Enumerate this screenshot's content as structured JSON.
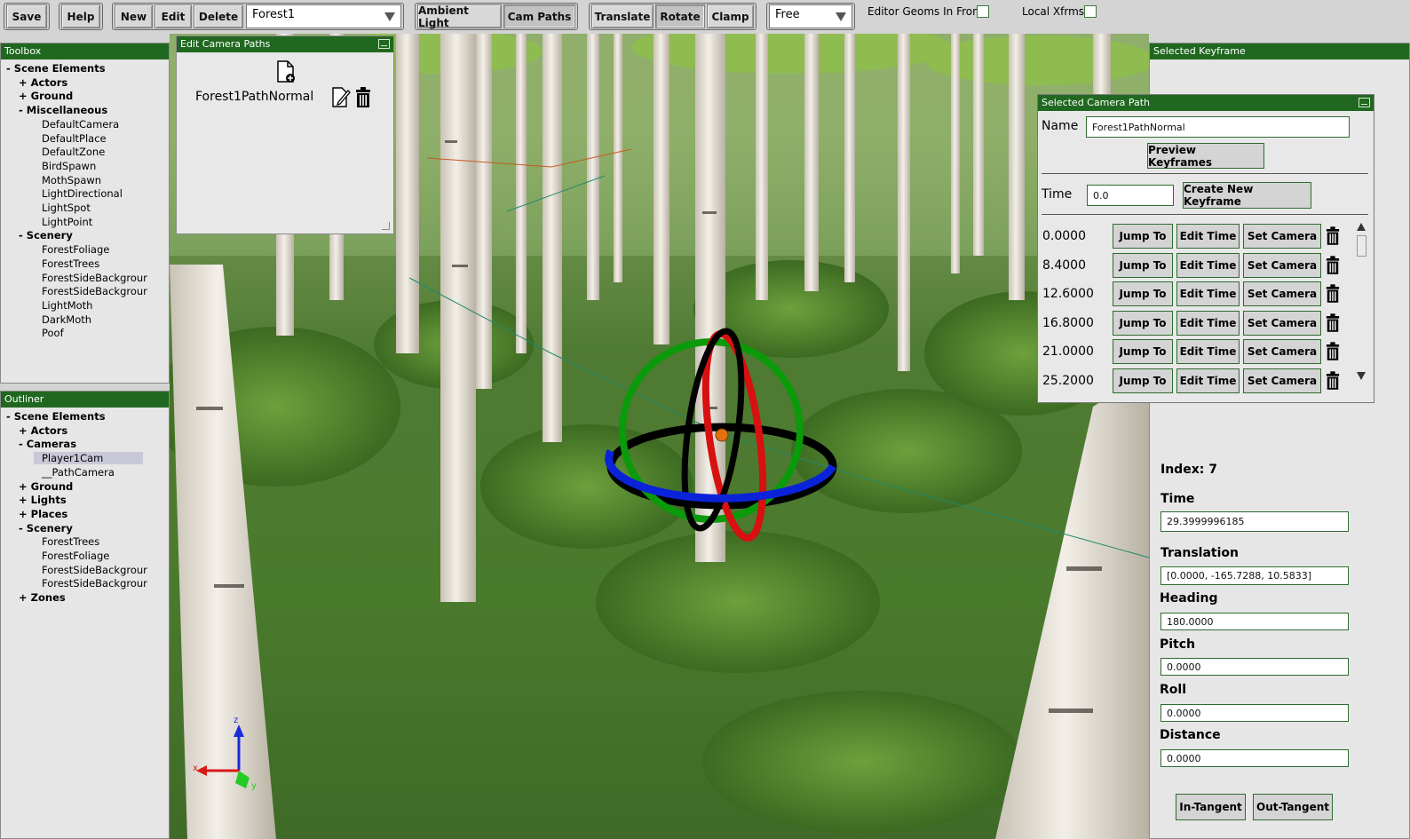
{
  "toolbar": {
    "save": "Save",
    "help": "Help",
    "new": "New",
    "edit": "Edit",
    "delete": "Delete",
    "level_select": "Forest1",
    "ambient_light": "Ambient Light",
    "cam_paths": "Cam Paths",
    "translate": "Translate",
    "rotate": "Rotate",
    "clamp": "Clamp",
    "camera_mode": "Free",
    "editor_geoms_label": "Editor Geoms In Front:",
    "local_xfrms_label": "Local Xfrms:"
  },
  "toolbox": {
    "title": "Toolbox",
    "items": [
      {
        "prefix": "-",
        "label": "Scene Elements",
        "level": 0,
        "bold": true
      },
      {
        "prefix": "+",
        "label": "Actors",
        "level": 1,
        "bold": true
      },
      {
        "prefix": "+",
        "label": "Ground",
        "level": 1,
        "bold": true
      },
      {
        "prefix": "-",
        "label": "Miscellaneous",
        "level": 1,
        "bold": true
      },
      {
        "prefix": "",
        "label": "DefaultCamera",
        "level": 2,
        "bold": false
      },
      {
        "prefix": "",
        "label": "DefaultPlace",
        "level": 2,
        "bold": false
      },
      {
        "prefix": "",
        "label": "DefaultZone",
        "level": 2,
        "bold": false
      },
      {
        "prefix": "",
        "label": "BirdSpawn",
        "level": 2,
        "bold": false
      },
      {
        "prefix": "",
        "label": "MothSpawn",
        "level": 2,
        "bold": false
      },
      {
        "prefix": "",
        "label": "LightDirectional",
        "level": 2,
        "bold": false
      },
      {
        "prefix": "",
        "label": "LightSpot",
        "level": 2,
        "bold": false
      },
      {
        "prefix": "",
        "label": "LightPoint",
        "level": 2,
        "bold": false
      },
      {
        "prefix": "-",
        "label": "Scenery",
        "level": 1,
        "bold": true
      },
      {
        "prefix": "",
        "label": "ForestFoliage",
        "level": 2,
        "bold": false
      },
      {
        "prefix": "",
        "label": "ForestTrees",
        "level": 2,
        "bold": false
      },
      {
        "prefix": "",
        "label": "ForestSideBackgrour",
        "level": 2,
        "bold": false
      },
      {
        "prefix": "",
        "label": "ForestSideBackgrour",
        "level": 2,
        "bold": false
      },
      {
        "prefix": "",
        "label": "LightMoth",
        "level": 2,
        "bold": false
      },
      {
        "prefix": "",
        "label": "DarkMoth",
        "level": 2,
        "bold": false
      },
      {
        "prefix": "",
        "label": "Poof",
        "level": 2,
        "bold": false
      }
    ]
  },
  "outliner": {
    "title": "Outliner",
    "items": [
      {
        "prefix": "-",
        "label": "Scene Elements",
        "level": 0,
        "bold": true,
        "selected": false
      },
      {
        "prefix": "+",
        "label": "Actors",
        "level": 1,
        "bold": true,
        "selected": false
      },
      {
        "prefix": "-",
        "label": "Cameras",
        "level": 1,
        "bold": true,
        "selected": false
      },
      {
        "prefix": "",
        "label": "Player1Cam",
        "level": 2,
        "bold": false,
        "selected": true
      },
      {
        "prefix": "",
        "label": "__PathCamera",
        "level": 2,
        "bold": false,
        "selected": false
      },
      {
        "prefix": "+",
        "label": "Ground",
        "level": 1,
        "bold": true,
        "selected": false
      },
      {
        "prefix": "+",
        "label": "Lights",
        "level": 1,
        "bold": true,
        "selected": false
      },
      {
        "prefix": "+",
        "label": "Places",
        "level": 1,
        "bold": true,
        "selected": false
      },
      {
        "prefix": "-",
        "label": "Scenery",
        "level": 1,
        "bold": true,
        "selected": false
      },
      {
        "prefix": "",
        "label": "ForestTrees",
        "level": 2,
        "bold": false,
        "selected": false
      },
      {
        "prefix": "",
        "label": "ForestFoliage",
        "level": 2,
        "bold": false,
        "selected": false
      },
      {
        "prefix": "",
        "label": "ForestSideBackgrour",
        "level": 2,
        "bold": false,
        "selected": false
      },
      {
        "prefix": "",
        "label": "ForestSideBackgrour",
        "level": 2,
        "bold": false,
        "selected": false
      },
      {
        "prefix": "+",
        "label": "Zones",
        "level": 1,
        "bold": true,
        "selected": false
      }
    ]
  },
  "edit_camera_paths": {
    "title": "Edit Camera Paths",
    "path_name": "Forest1PathNormal"
  },
  "selected_camera_path": {
    "title": "Selected Camera Path",
    "name_label": "Name",
    "name_value": "Forest1PathNormal",
    "preview_button": "Preview Keyframes",
    "time_label": "Time",
    "time_value": "0.0",
    "create_button": "Create New Keyframe",
    "jump_label": "Jump To",
    "edit_time_label": "Edit Time",
    "set_camera_label": "Set Camera",
    "keyframes": [
      "0.0000",
      "8.4000",
      "12.6000",
      "16.8000",
      "21.0000",
      "25.2000"
    ]
  },
  "selected_keyframe": {
    "title": "Selected Keyframe",
    "index_label": "Index: 7",
    "time_label": "Time",
    "time_value": "29.3999996185",
    "translation_label": "Translation",
    "translation_value": "[0.0000, -165.7288, 10.5833]",
    "heading_label": "Heading",
    "heading_value": "180.0000",
    "pitch_label": "Pitch",
    "pitch_value": "0.0000",
    "roll_label": "Roll",
    "roll_value": "0.0000",
    "distance_label": "Distance",
    "distance_value": "0.0000",
    "in_tangent": "In-Tangent",
    "out_tangent": "Out-Tangent"
  },
  "axis_gizmo": {
    "x": "x",
    "y": "y",
    "z": "z"
  },
  "colors": {
    "panel_title": "#206820",
    "accent_border": "#2f6b2f"
  }
}
